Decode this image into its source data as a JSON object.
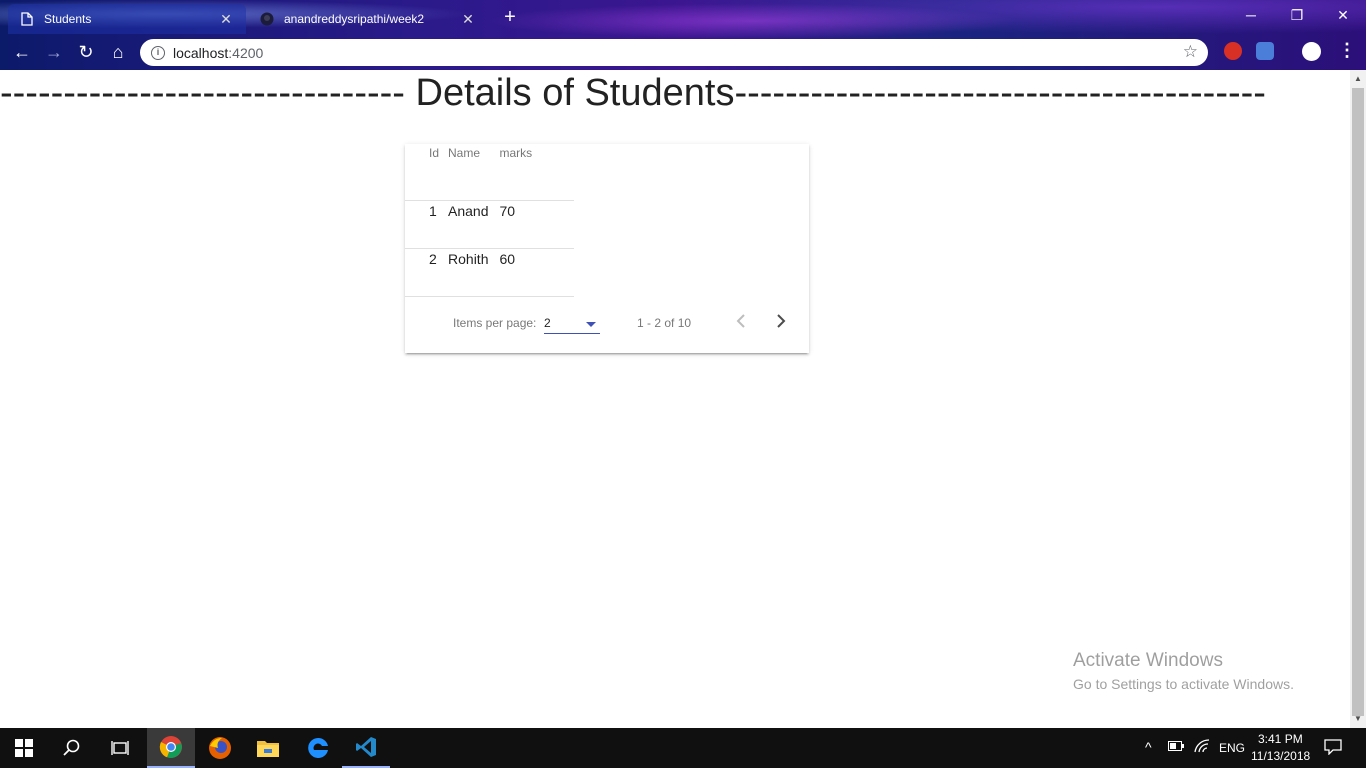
{
  "browser": {
    "tabs": [
      {
        "title": "Students",
        "active": true
      },
      {
        "title": "anandreddysripathi/week2",
        "active": false
      }
    ],
    "url_host": "localhost",
    "url_port": ":4200"
  },
  "page": {
    "heading": "-------------------------------- Details of Students------------------------------------------",
    "table": {
      "columns": [
        "Id",
        "Name",
        "marks"
      ],
      "rows": [
        [
          "1",
          "Anand",
          "70"
        ],
        [
          "2",
          "Rohith",
          "60"
        ]
      ]
    },
    "paginator": {
      "items_per_page_label": "Items per page:",
      "page_size": "2",
      "range_label": "1 - 2 of 10"
    }
  },
  "watermark": {
    "line1": "Activate Windows",
    "line2": "Go to Settings to activate Windows."
  },
  "taskbar": {
    "language": "ENG",
    "time": "3:41 PM",
    "date": "11/13/2018"
  },
  "colors": {
    "accent": "#3f51b5"
  }
}
